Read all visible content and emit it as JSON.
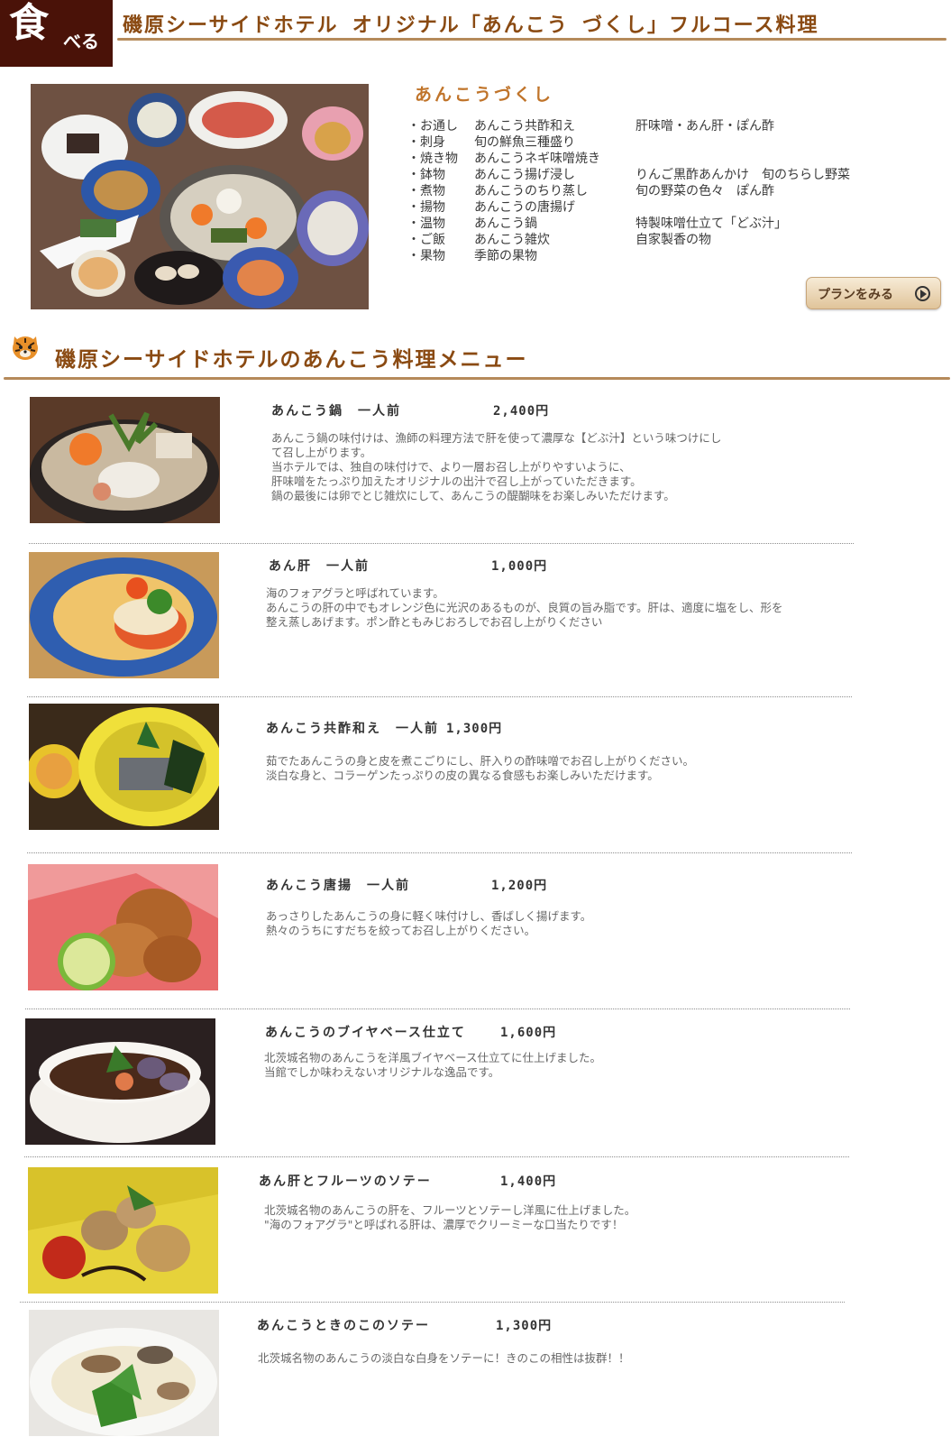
{
  "header": {
    "logo_big": "食",
    "logo_small": "べる",
    "title": "磯原シーサイドホテル オリジナル「あんこう づくし」フルコース料理"
  },
  "course": {
    "title": "あんこうづくし",
    "rows": [
      {
        "category": "・お通し",
        "name": "あんこう共酢和え",
        "note": "肝味噌・あん肝・ぽん酢"
      },
      {
        "category": "・刺身",
        "name": "旬の鮮魚三種盛り",
        "note": ""
      },
      {
        "category": "・焼き物",
        "name": "あんこうネギ味噌焼き",
        "note": ""
      },
      {
        "category": "・鉢物",
        "name": "あんこう揚げ浸し",
        "note": "りんご黒酢あんかけ　旬のちらし野菜"
      },
      {
        "category": "・煮物",
        "name": "あんこうのちり蒸し",
        "note": "旬の野菜の色々　ぽん酢"
      },
      {
        "category": "・揚物",
        "name": "あんこうの唐揚げ",
        "note": ""
      },
      {
        "category": "・温物",
        "name": "あんこう鍋",
        "note": "特製味噌仕立て「どぶ汁」"
      },
      {
        "category": "・ご飯",
        "name": "あんこう雑炊",
        "note": "自家製香の物"
      },
      {
        "category": "・果物",
        "name": "季節の果物",
        "note": ""
      }
    ],
    "plan_button_label": "プランをみる"
  },
  "menu": {
    "title": "磯原シーサイドホテルのあんこう料理メニュー",
    "items": [
      {
        "name": "あんこう鍋　一人前",
        "price": "2,400円",
        "description": "あんこう鍋の味付けは、漁師の料理方法で肝を使って濃厚な【どぶ汁】という味つけにし\nて召し上がります。\n当ホテルでは、独自の味付けで、より一層お召し上がりやすいように、\n肝味噌をたっぷり加えたオリジナルの出汁で召し上がっていただきます。\n鍋の最後には卵でとじ雑炊にして、あんこうの醍醐味をお楽しみいただけます。"
      },
      {
        "name": "あん肝　一人前",
        "price": "1,000円",
        "description": "海のフォアグラと呼ばれています。\nあんこうの肝の中でもオレンジ色に光沢のあるものが、良質の旨み脂です。肝は、適度に塩をし、形を\n整え蒸しあげます。ポン酢ともみじおろしでお召し上がりください"
      },
      {
        "name": "あんこう共酢和え　一人前",
        "price": "1,300円",
        "description": "茹でたあんこうの身と皮を煮こごりにし、肝入りの酢味噌でお召し上がりください。\n淡白な身と、コラーゲンたっぷりの皮の異なる食感もお楽しみいただけます。"
      },
      {
        "name": "あんこう唐揚　一人前",
        "price": "1,200円",
        "description": "あっさりしたあんこうの身に軽く味付けし、香ばしく揚げます。\n熱々のうちにすだちを絞ってお召し上がりください。"
      },
      {
        "name": "あんこうのブイヤベース仕立て",
        "price": "1,600円",
        "description": "北茨城名物のあんこうを洋風ブイヤベース仕立てに仕上げました。\n当館でしか味わえないオリジナルな逸品です。"
      },
      {
        "name": "あん肝とフルーツのソテー",
        "price": "1,400円",
        "description": "北茨城名物のあんこうの肝を、フルーツとソテーし洋風に仕上げました。\n\"海のフォアグラ\"と呼ばれる肝は、濃厚でクリーミーな口当たりです！"
      },
      {
        "name": "あんこうときのこのソテー",
        "price": "1,300円",
        "description": "北茨城名物のあんこうの淡白な白身をソテーに！きのこの相性は抜群！！"
      }
    ]
  }
}
